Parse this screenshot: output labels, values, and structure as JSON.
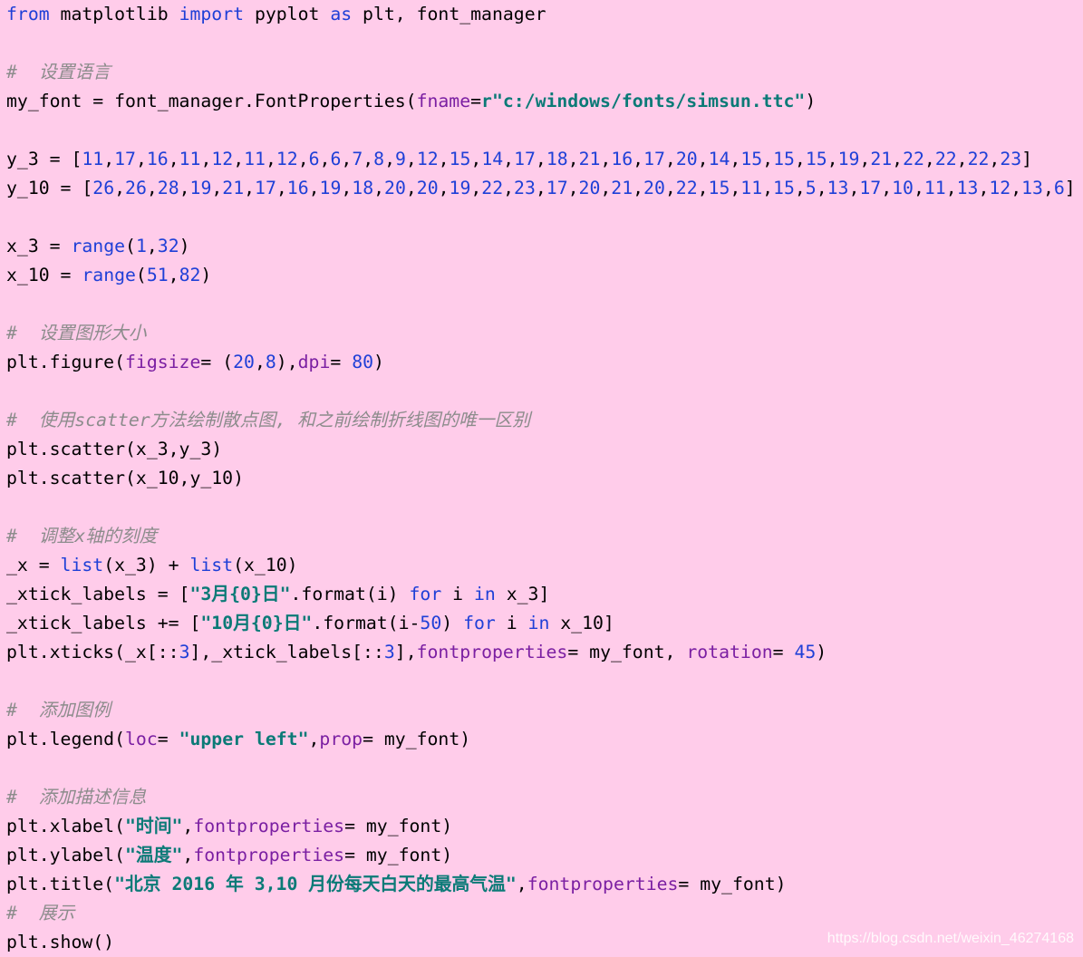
{
  "code_lines": [
    {
      "tokens": [
        {
          "text": "from",
          "cls": "kw"
        },
        {
          "text": " matplotlib ",
          "cls": ""
        },
        {
          "text": "import",
          "cls": "kw"
        },
        {
          "text": " pyplot ",
          "cls": ""
        },
        {
          "text": "as",
          "cls": "kw"
        },
        {
          "text": " plt, font_manager",
          "cls": ""
        }
      ]
    },
    {
      "tokens": []
    },
    {
      "tokens": [
        {
          "text": "#  设置语言",
          "cls": "comment"
        }
      ]
    },
    {
      "tokens": [
        {
          "text": "my_font = font_manager.FontProperties(",
          "cls": ""
        },
        {
          "text": "fname",
          "cls": "param"
        },
        {
          "text": "=",
          "cls": ""
        },
        {
          "text": "r\"c:/windows/fonts/simsun.ttc\"",
          "cls": "str"
        },
        {
          "text": ")",
          "cls": ""
        }
      ]
    },
    {
      "tokens": []
    },
    {
      "tokens": [
        {
          "text": "y_3 = [",
          "cls": ""
        },
        {
          "text": "11",
          "cls": "num"
        },
        {
          "text": ",",
          "cls": ""
        },
        {
          "text": "17",
          "cls": "num"
        },
        {
          "text": ",",
          "cls": ""
        },
        {
          "text": "16",
          "cls": "num"
        },
        {
          "text": ",",
          "cls": ""
        },
        {
          "text": "11",
          "cls": "num"
        },
        {
          "text": ",",
          "cls": ""
        },
        {
          "text": "12",
          "cls": "num"
        },
        {
          "text": ",",
          "cls": ""
        },
        {
          "text": "11",
          "cls": "num"
        },
        {
          "text": ",",
          "cls": ""
        },
        {
          "text": "12",
          "cls": "num"
        },
        {
          "text": ",",
          "cls": ""
        },
        {
          "text": "6",
          "cls": "num"
        },
        {
          "text": ",",
          "cls": ""
        },
        {
          "text": "6",
          "cls": "num"
        },
        {
          "text": ",",
          "cls": ""
        },
        {
          "text": "7",
          "cls": "num"
        },
        {
          "text": ",",
          "cls": ""
        },
        {
          "text": "8",
          "cls": "num"
        },
        {
          "text": ",",
          "cls": ""
        },
        {
          "text": "9",
          "cls": "num"
        },
        {
          "text": ",",
          "cls": ""
        },
        {
          "text": "12",
          "cls": "num"
        },
        {
          "text": ",",
          "cls": ""
        },
        {
          "text": "15",
          "cls": "num"
        },
        {
          "text": ",",
          "cls": ""
        },
        {
          "text": "14",
          "cls": "num"
        },
        {
          "text": ",",
          "cls": ""
        },
        {
          "text": "17",
          "cls": "num"
        },
        {
          "text": ",",
          "cls": ""
        },
        {
          "text": "18",
          "cls": "num"
        },
        {
          "text": ",",
          "cls": ""
        },
        {
          "text": "21",
          "cls": "num"
        },
        {
          "text": ",",
          "cls": ""
        },
        {
          "text": "16",
          "cls": "num"
        },
        {
          "text": ",",
          "cls": ""
        },
        {
          "text": "17",
          "cls": "num"
        },
        {
          "text": ",",
          "cls": ""
        },
        {
          "text": "20",
          "cls": "num"
        },
        {
          "text": ",",
          "cls": ""
        },
        {
          "text": "14",
          "cls": "num"
        },
        {
          "text": ",",
          "cls": ""
        },
        {
          "text": "15",
          "cls": "num"
        },
        {
          "text": ",",
          "cls": ""
        },
        {
          "text": "15",
          "cls": "num"
        },
        {
          "text": ",",
          "cls": ""
        },
        {
          "text": "15",
          "cls": "num"
        },
        {
          "text": ",",
          "cls": ""
        },
        {
          "text": "19",
          "cls": "num"
        },
        {
          "text": ",",
          "cls": ""
        },
        {
          "text": "21",
          "cls": "num"
        },
        {
          "text": ",",
          "cls": ""
        },
        {
          "text": "22",
          "cls": "num"
        },
        {
          "text": ",",
          "cls": ""
        },
        {
          "text": "22",
          "cls": "num"
        },
        {
          "text": ",",
          "cls": ""
        },
        {
          "text": "22",
          "cls": "num"
        },
        {
          "text": ",",
          "cls": ""
        },
        {
          "text": "23",
          "cls": "num"
        },
        {
          "text": "]",
          "cls": ""
        }
      ]
    },
    {
      "tokens": [
        {
          "text": "y_10 = [",
          "cls": ""
        },
        {
          "text": "26",
          "cls": "num"
        },
        {
          "text": ",",
          "cls": ""
        },
        {
          "text": "26",
          "cls": "num"
        },
        {
          "text": ",",
          "cls": ""
        },
        {
          "text": "28",
          "cls": "num"
        },
        {
          "text": ",",
          "cls": ""
        },
        {
          "text": "19",
          "cls": "num"
        },
        {
          "text": ",",
          "cls": ""
        },
        {
          "text": "21",
          "cls": "num"
        },
        {
          "text": ",",
          "cls": ""
        },
        {
          "text": "17",
          "cls": "num"
        },
        {
          "text": ",",
          "cls": ""
        },
        {
          "text": "16",
          "cls": "num"
        },
        {
          "text": ",",
          "cls": ""
        },
        {
          "text": "19",
          "cls": "num"
        },
        {
          "text": ",",
          "cls": ""
        },
        {
          "text": "18",
          "cls": "num"
        },
        {
          "text": ",",
          "cls": ""
        },
        {
          "text": "20",
          "cls": "num"
        },
        {
          "text": ",",
          "cls": ""
        },
        {
          "text": "20",
          "cls": "num"
        },
        {
          "text": ",",
          "cls": ""
        },
        {
          "text": "19",
          "cls": "num"
        },
        {
          "text": ",",
          "cls": ""
        },
        {
          "text": "22",
          "cls": "num"
        },
        {
          "text": ",",
          "cls": ""
        },
        {
          "text": "23",
          "cls": "num"
        },
        {
          "text": ",",
          "cls": ""
        },
        {
          "text": "17",
          "cls": "num"
        },
        {
          "text": ",",
          "cls": ""
        },
        {
          "text": "20",
          "cls": "num"
        },
        {
          "text": ",",
          "cls": ""
        },
        {
          "text": "21",
          "cls": "num"
        },
        {
          "text": ",",
          "cls": ""
        },
        {
          "text": "20",
          "cls": "num"
        },
        {
          "text": ",",
          "cls": ""
        },
        {
          "text": "22",
          "cls": "num"
        },
        {
          "text": ",",
          "cls": ""
        },
        {
          "text": "15",
          "cls": "num"
        },
        {
          "text": ",",
          "cls": ""
        },
        {
          "text": "11",
          "cls": "num"
        },
        {
          "text": ",",
          "cls": ""
        },
        {
          "text": "15",
          "cls": "num"
        },
        {
          "text": ",",
          "cls": ""
        },
        {
          "text": "5",
          "cls": "num"
        },
        {
          "text": ",",
          "cls": ""
        },
        {
          "text": "13",
          "cls": "num"
        },
        {
          "text": ",",
          "cls": ""
        },
        {
          "text": "17",
          "cls": "num"
        },
        {
          "text": ",",
          "cls": ""
        },
        {
          "text": "10",
          "cls": "num"
        },
        {
          "text": ",",
          "cls": ""
        },
        {
          "text": "11",
          "cls": "num"
        },
        {
          "text": ",",
          "cls": ""
        },
        {
          "text": "13",
          "cls": "num"
        },
        {
          "text": ",",
          "cls": ""
        },
        {
          "text": "12",
          "cls": "num"
        },
        {
          "text": ",",
          "cls": ""
        },
        {
          "text": "13",
          "cls": "num"
        },
        {
          "text": ",",
          "cls": ""
        },
        {
          "text": "6",
          "cls": "num"
        },
        {
          "text": "]",
          "cls": ""
        }
      ]
    },
    {
      "tokens": []
    },
    {
      "tokens": [
        {
          "text": "x_3 = ",
          "cls": ""
        },
        {
          "text": "range",
          "cls": "fn"
        },
        {
          "text": "(",
          "cls": ""
        },
        {
          "text": "1",
          "cls": "num"
        },
        {
          "text": ",",
          "cls": ""
        },
        {
          "text": "32",
          "cls": "num"
        },
        {
          "text": ")",
          "cls": ""
        }
      ]
    },
    {
      "tokens": [
        {
          "text": "x_10 = ",
          "cls": ""
        },
        {
          "text": "range",
          "cls": "fn"
        },
        {
          "text": "(",
          "cls": ""
        },
        {
          "text": "51",
          "cls": "num"
        },
        {
          "text": ",",
          "cls": ""
        },
        {
          "text": "82",
          "cls": "num"
        },
        {
          "text": ")",
          "cls": ""
        }
      ]
    },
    {
      "tokens": []
    },
    {
      "tokens": [
        {
          "text": "#  设置图形大小",
          "cls": "comment"
        }
      ]
    },
    {
      "tokens": [
        {
          "text": "plt.figure(",
          "cls": ""
        },
        {
          "text": "figsize",
          "cls": "param"
        },
        {
          "text": "= (",
          "cls": ""
        },
        {
          "text": "20",
          "cls": "num"
        },
        {
          "text": ",",
          "cls": ""
        },
        {
          "text": "8",
          "cls": "num"
        },
        {
          "text": "),",
          "cls": ""
        },
        {
          "text": "dpi",
          "cls": "param"
        },
        {
          "text": "= ",
          "cls": ""
        },
        {
          "text": "80",
          "cls": "num"
        },
        {
          "text": ")",
          "cls": ""
        }
      ]
    },
    {
      "tokens": []
    },
    {
      "tokens": [
        {
          "text": "#  使用scatter方法绘制散点图, 和之前绘制折线图的唯一区别",
          "cls": "comment"
        }
      ]
    },
    {
      "tokens": [
        {
          "text": "plt.scatter(x_3,y_3)",
          "cls": ""
        }
      ]
    },
    {
      "tokens": [
        {
          "text": "plt.scatter(x_10,y_10)",
          "cls": ""
        }
      ]
    },
    {
      "tokens": []
    },
    {
      "tokens": [
        {
          "text": "#  调整x轴的刻度",
          "cls": "comment"
        }
      ]
    },
    {
      "tokens": [
        {
          "text": "_x = ",
          "cls": ""
        },
        {
          "text": "list",
          "cls": "fn"
        },
        {
          "text": "(x_3) + ",
          "cls": ""
        },
        {
          "text": "list",
          "cls": "fn"
        },
        {
          "text": "(x_10)",
          "cls": ""
        }
      ]
    },
    {
      "tokens": [
        {
          "text": "_xtick_labels = [",
          "cls": ""
        },
        {
          "text": "\"3月{0}日\"",
          "cls": "str"
        },
        {
          "text": ".format(i) ",
          "cls": ""
        },
        {
          "text": "for",
          "cls": "kw"
        },
        {
          "text": " i ",
          "cls": ""
        },
        {
          "text": "in",
          "cls": "kw"
        },
        {
          "text": " x_3]",
          "cls": ""
        }
      ]
    },
    {
      "tokens": [
        {
          "text": "_xtick_labels += [",
          "cls": ""
        },
        {
          "text": "\"10月{0}日\"",
          "cls": "str"
        },
        {
          "text": ".format(i-",
          "cls": ""
        },
        {
          "text": "50",
          "cls": "num"
        },
        {
          "text": ") ",
          "cls": ""
        },
        {
          "text": "for",
          "cls": "kw"
        },
        {
          "text": " i ",
          "cls": ""
        },
        {
          "text": "in",
          "cls": "kw"
        },
        {
          "text": " x_10]",
          "cls": ""
        }
      ]
    },
    {
      "tokens": [
        {
          "text": "plt.xticks(_x[::",
          "cls": ""
        },
        {
          "text": "3",
          "cls": "num"
        },
        {
          "text": "],_xtick_labels[::",
          "cls": ""
        },
        {
          "text": "3",
          "cls": "num"
        },
        {
          "text": "],",
          "cls": ""
        },
        {
          "text": "fontproperties",
          "cls": "param"
        },
        {
          "text": "= my_font, ",
          "cls": ""
        },
        {
          "text": "rotation",
          "cls": "param"
        },
        {
          "text": "= ",
          "cls": ""
        },
        {
          "text": "45",
          "cls": "num"
        },
        {
          "text": ")",
          "cls": ""
        }
      ]
    },
    {
      "tokens": []
    },
    {
      "tokens": [
        {
          "text": "#  添加图例",
          "cls": "comment"
        }
      ]
    },
    {
      "tokens": [
        {
          "text": "plt.legend(",
          "cls": ""
        },
        {
          "text": "loc",
          "cls": "param"
        },
        {
          "text": "= ",
          "cls": ""
        },
        {
          "text": "\"upper left\"",
          "cls": "str"
        },
        {
          "text": ",",
          "cls": ""
        },
        {
          "text": "prop",
          "cls": "param"
        },
        {
          "text": "= my_font)",
          "cls": ""
        }
      ]
    },
    {
      "tokens": []
    },
    {
      "tokens": [
        {
          "text": "#  添加描述信息",
          "cls": "comment"
        }
      ]
    },
    {
      "tokens": [
        {
          "text": "plt.xlabel(",
          "cls": ""
        },
        {
          "text": "\"时间\"",
          "cls": "str"
        },
        {
          "text": ",",
          "cls": ""
        },
        {
          "text": "fontproperties",
          "cls": "param"
        },
        {
          "text": "= my_font)",
          "cls": ""
        }
      ]
    },
    {
      "tokens": [
        {
          "text": "plt.ylabel(",
          "cls": ""
        },
        {
          "text": "\"温度\"",
          "cls": "str"
        },
        {
          "text": ",",
          "cls": ""
        },
        {
          "text": "fontproperties",
          "cls": "param"
        },
        {
          "text": "= my_font)",
          "cls": ""
        }
      ]
    },
    {
      "tokens": [
        {
          "text": "plt.title(",
          "cls": ""
        },
        {
          "text": "\"北京 2016 年 3,10 月份每天白天的最高气温\"",
          "cls": "str"
        },
        {
          "text": ",",
          "cls": ""
        },
        {
          "text": "fontproperties",
          "cls": "param"
        },
        {
          "text": "= my_font)",
          "cls": ""
        }
      ]
    },
    {
      "tokens": [
        {
          "text": "#  展示",
          "cls": "comment"
        }
      ]
    },
    {
      "tokens": [
        {
          "text": "plt.show()",
          "cls": ""
        }
      ]
    }
  ],
  "watermark": "https://blog.csdn.net/weixin_46274168"
}
